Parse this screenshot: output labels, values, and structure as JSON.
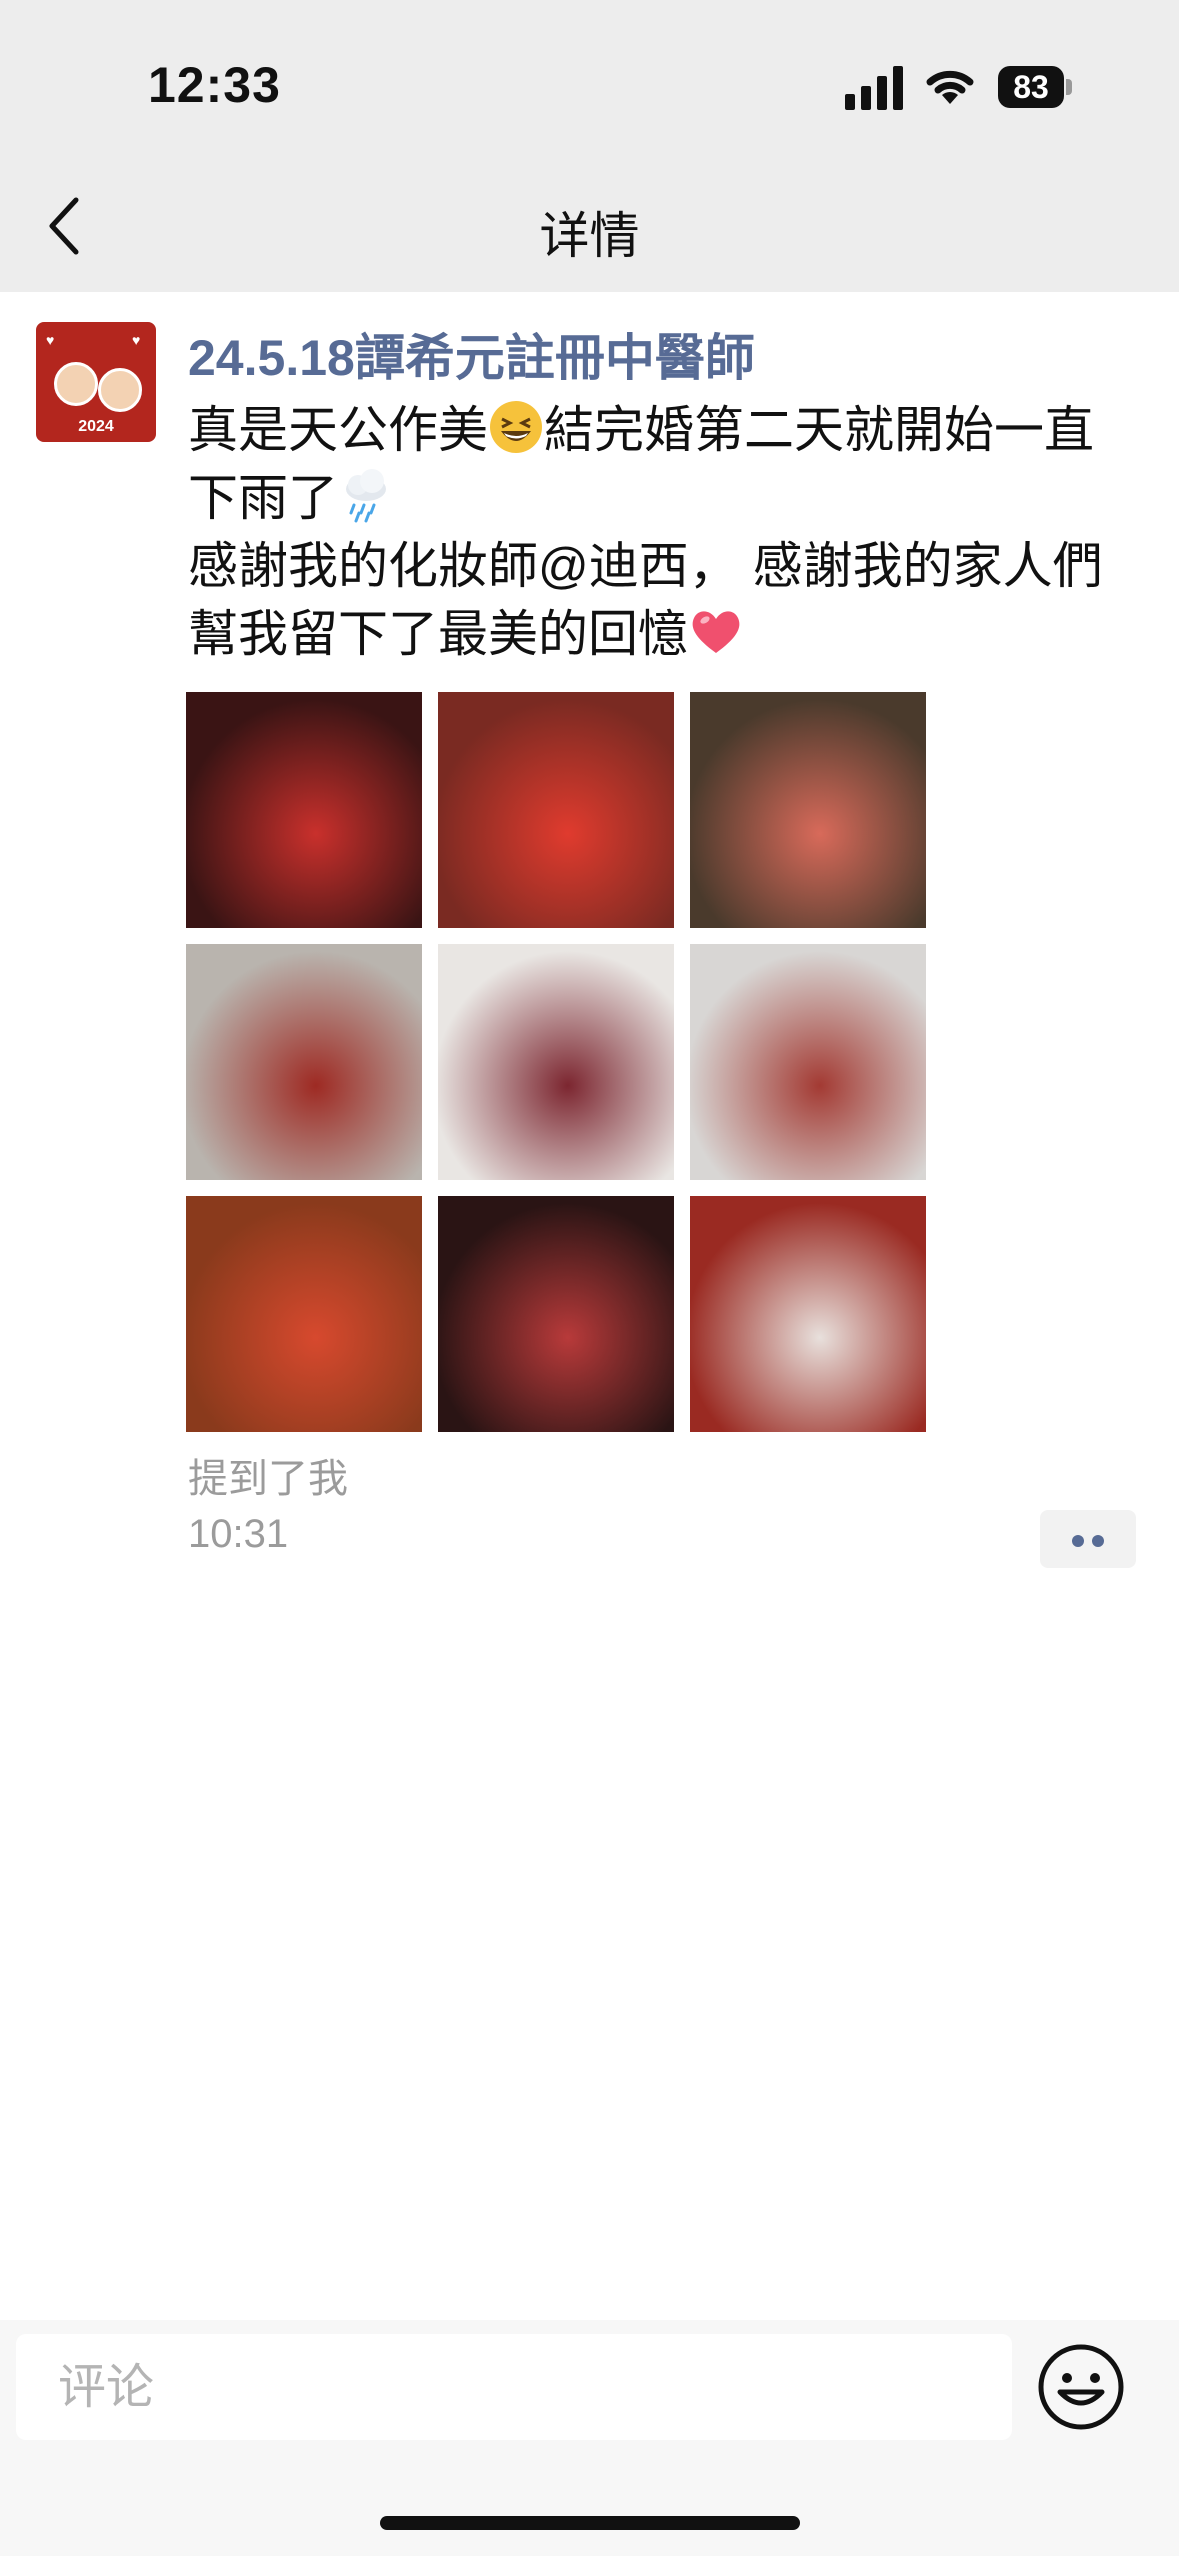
{
  "status_bar": {
    "time": "12:33",
    "battery": "83"
  },
  "nav": {
    "title": "详情"
  },
  "post": {
    "username": "24.5.18譚希元註冊中醫師",
    "lines": [
      {
        "before": "真是天公作美",
        "emoji": "grinning-squinting-face",
        "after": "結完婚第二天就開始一直"
      },
      {
        "before": "下雨了",
        "emoji": "cloud-with-rain",
        "after": ""
      },
      {
        "before": "感謝我的化妝師@迪西， 感謝我的家人們",
        "emoji": "",
        "after": ""
      },
      {
        "before": "幫我留下了最美的回憶",
        "emoji": "red-heart",
        "after": ""
      }
    ],
    "images": [
      {
        "name": "photo-1",
        "bg": "#3a1414",
        "accent": "#c9302c"
      },
      {
        "name": "photo-2",
        "bg": "#7a2a22",
        "accent": "#e03b2e"
      },
      {
        "name": "photo-3",
        "bg": "#4a3a2c",
        "accent": "#d86a5a"
      },
      {
        "name": "photo-4",
        "bg": "#b9b4ae",
        "accent": "#9e2a23"
      },
      {
        "name": "photo-5",
        "bg": "#e9e6e3",
        "accent": "#7c2630"
      },
      {
        "name": "photo-6",
        "bg": "#d8d6d4",
        "accent": "#a33a33"
      },
      {
        "name": "photo-7",
        "bg": "#8a3a1c",
        "accent": "#d7492e"
      },
      {
        "name": "photo-8",
        "bg": "#2a1414",
        "accent": "#b83a3a"
      },
      {
        "name": "photo-9",
        "bg": "#9a2a22",
        "accent": "#e8e0dc"
      }
    ],
    "mention_label": "提到了我",
    "time": "10:31"
  },
  "comment": {
    "placeholder": "评论",
    "emoji_icon": "smile-icon"
  },
  "colors": {
    "link": "#576b95",
    "nav_bg": "#ededed"
  }
}
